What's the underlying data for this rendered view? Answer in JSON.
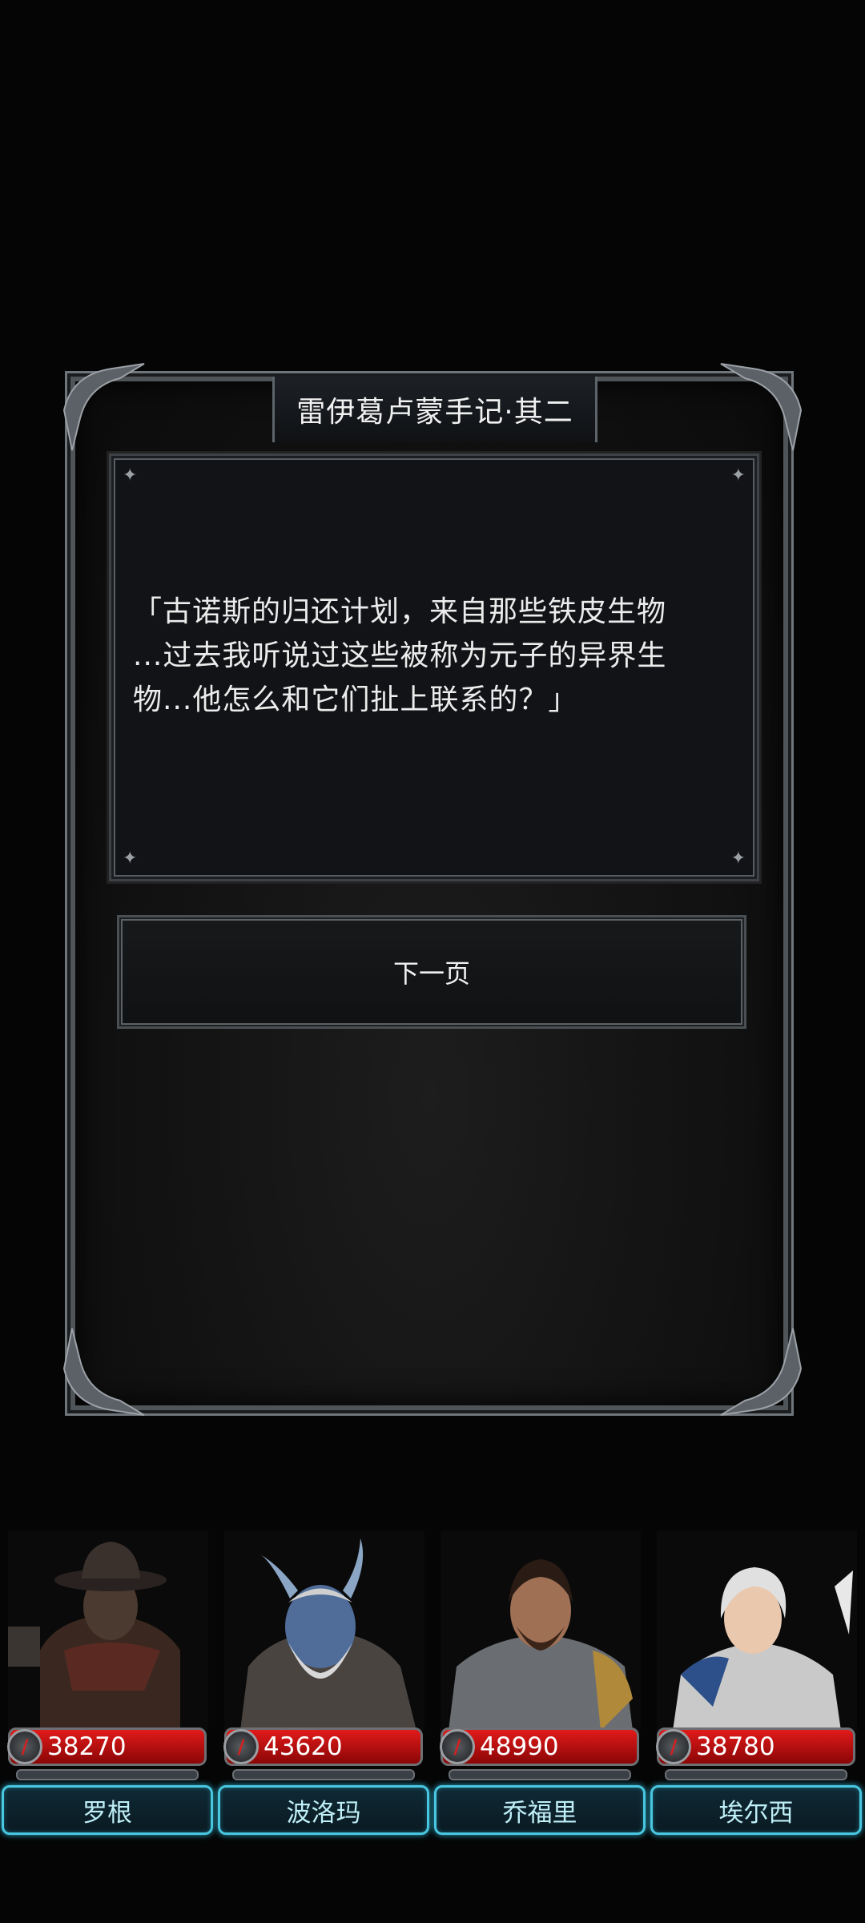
{
  "dialog": {
    "title": "雷伊葛卢蒙手记·其二",
    "lines": [
      "「古诺斯的归还计划，来自那些铁皮生物",
      "...过去我听说过这些被称为元子的异界生",
      "物...他怎么和它们扯上联系的？」"
    ],
    "next_label": "下一页"
  },
  "party": [
    {
      "name": "罗根",
      "hp": "38270"
    },
    {
      "name": "波洛玛",
      "hp": "43620"
    },
    {
      "name": "乔福里",
      "hp": "48990"
    },
    {
      "name": "埃尔西",
      "hp": "38780"
    }
  ],
  "colors": {
    "hp_bar": "#e11a1a",
    "name_border": "#49c7e0",
    "frame": "#4f5458"
  },
  "icons": [
    "sword-icon",
    "star-ornament-icon"
  ]
}
